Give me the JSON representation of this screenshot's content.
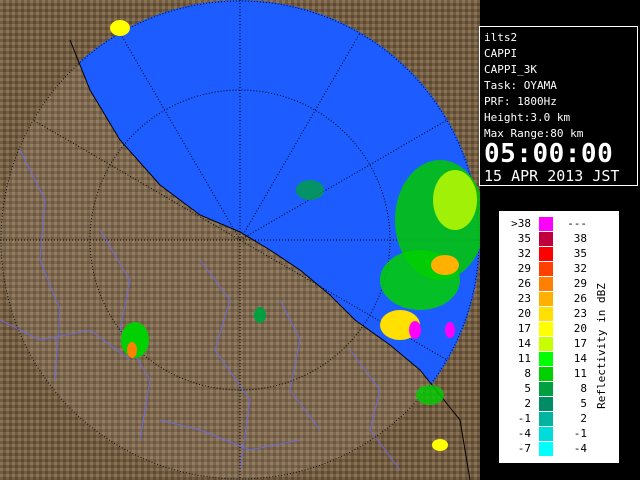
{
  "info": {
    "lines": [
      "ilts2",
      "CAPPI",
      "CAPPI_3K",
      "Task: OYAMA",
      "PRF: 1800Hz",
      "Height:3.0 km",
      "Max Range:80 km"
    ],
    "time": "05:00:00",
    "date": "15 APR 2013 JST"
  },
  "legend": {
    "title": "Reflectivity in dBZ",
    "rows": [
      {
        "lo": ">38",
        "hi": "---",
        "color": "#ff00ff"
      },
      {
        "lo": "35",
        "hi": "38",
        "color": "#c0003c"
      },
      {
        "lo": "32",
        "hi": "35",
        "color": "#ff0000"
      },
      {
        "lo": "29",
        "hi": "32",
        "color": "#ff4000"
      },
      {
        "lo": "26",
        "hi": "29",
        "color": "#ff8000"
      },
      {
        "lo": "23",
        "hi": "26",
        "color": "#ffb000"
      },
      {
        "lo": "20",
        "hi": "23",
        "color": "#ffe000"
      },
      {
        "lo": "17",
        "hi": "20",
        "color": "#ffff00"
      },
      {
        "lo": "14",
        "hi": "17",
        "color": "#c8ff00"
      },
      {
        "lo": "11",
        "hi": "14",
        "color": "#00ff00"
      },
      {
        "lo": "8",
        "hi": "11",
        "color": "#00d000"
      },
      {
        "lo": "5",
        "hi": "8",
        "color": "#00a040"
      },
      {
        "lo": "2",
        "hi": "5",
        "color": "#008c64"
      },
      {
        "lo": "-1",
        "hi": "2",
        "color": "#00b4a0"
      },
      {
        "lo": "-4",
        "hi": "-1",
        "color": "#00dcdc"
      },
      {
        "lo": "-7",
        "hi": "-4",
        "color": "#00ffff"
      }
    ]
  },
  "colors": {
    "sea": "#0a50ff",
    "land": "#7a6448",
    "range_ring": "#000000",
    "panel_text": "#ffffff"
  }
}
